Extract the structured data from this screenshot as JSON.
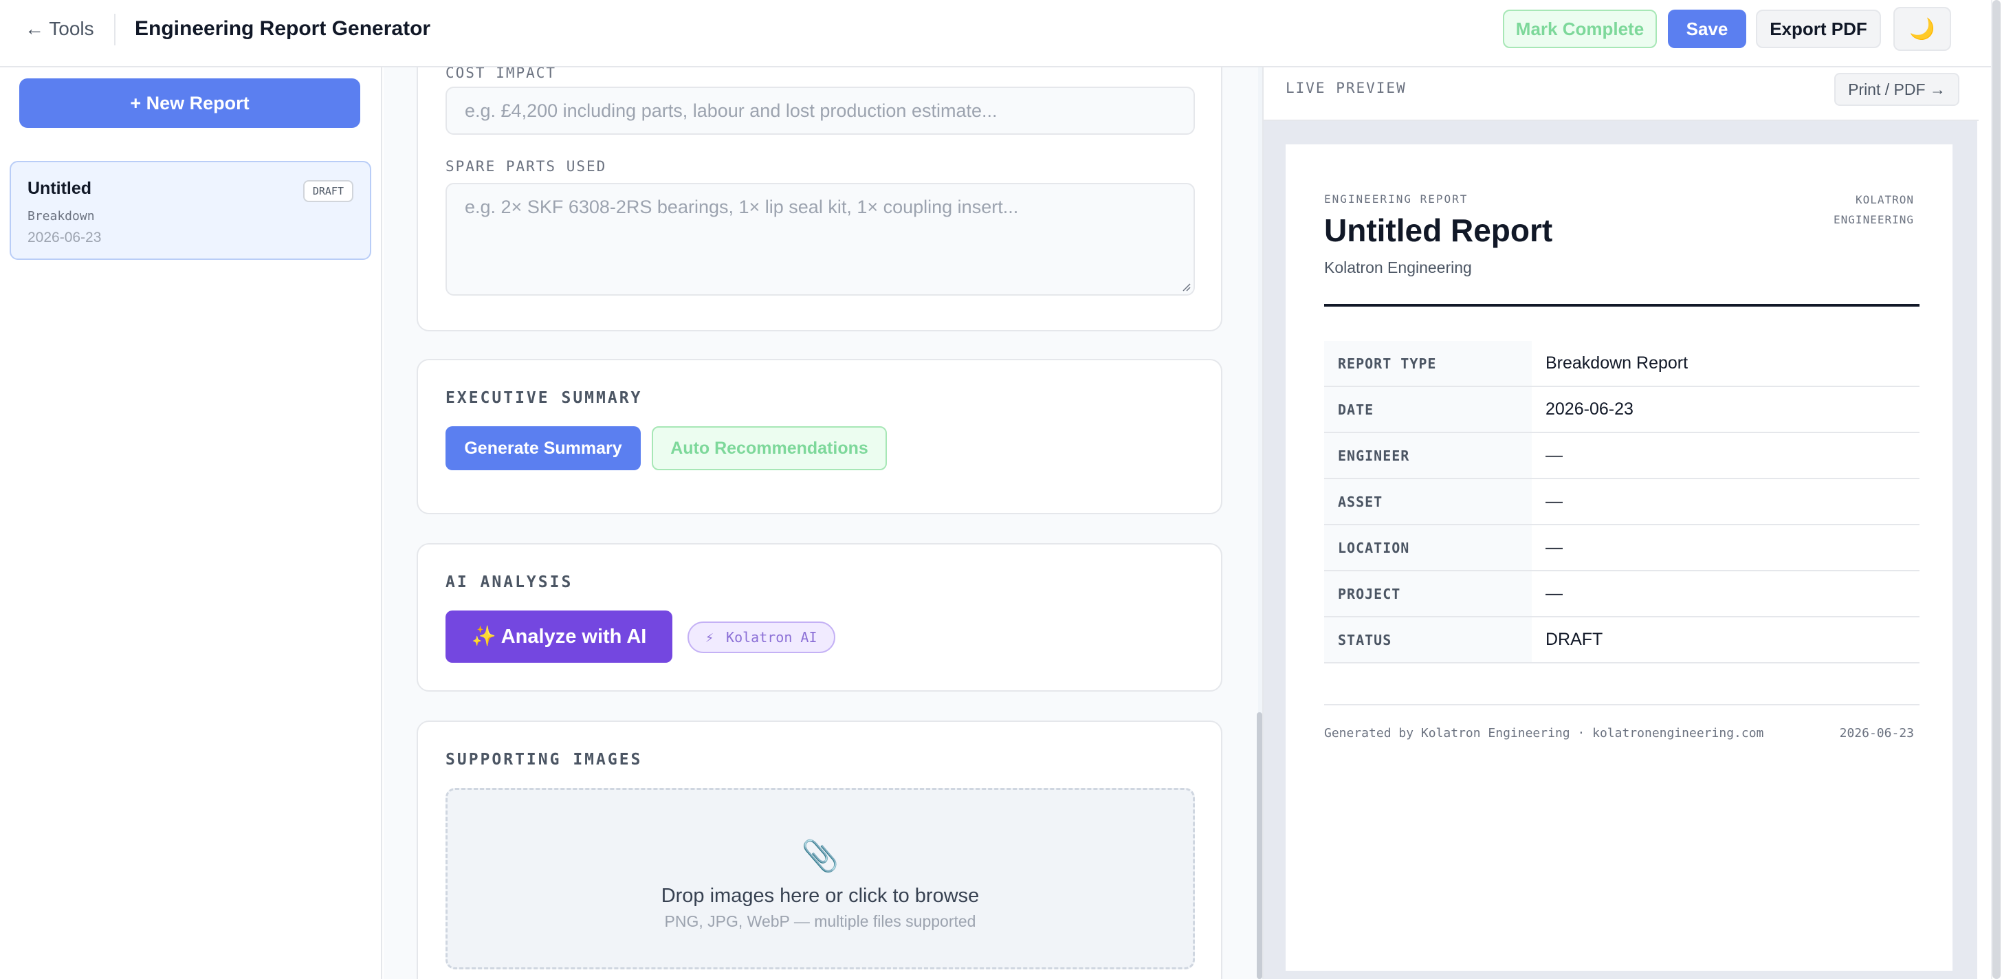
{
  "header": {
    "back_label": "← Tools",
    "title": "Engineering Report Generator",
    "mark_complete": "Mark Complete",
    "save": "Save",
    "export_pdf": "Export PDF",
    "theme_icon": "moon-icon",
    "theme_glyph": "🌙"
  },
  "sidebar": {
    "new_report": "+ New Report",
    "reports": [
      {
        "title": "Untitled",
        "badge": "DRAFT",
        "type": "Breakdown",
        "date": "2026-06-23"
      }
    ]
  },
  "form": {
    "cost_impact": {
      "label": "COST IMPACT",
      "placeholder": "e.g. £4,200 including parts, labour and lost production estimate..."
    },
    "spare_parts": {
      "label": "SPARE PARTS USED",
      "placeholder": "e.g. 2× SKF 6308-2RS bearings, 1× lip seal kit, 1× coupling insert..."
    },
    "executive_summary": {
      "title": "EXECUTIVE SUMMARY",
      "generate": "Generate Summary",
      "auto": "Auto Recommendations"
    },
    "ai_analysis": {
      "title": "AI ANALYSIS",
      "analyze": "✨ Analyze with AI",
      "badge_icon": "⚡",
      "badge": "Kolatron AI"
    },
    "supporting_images": {
      "title": "SUPPORTING IMAGES",
      "icon": "📎",
      "drop": "Drop images here or click to browse",
      "hint": "PNG, JPG, WebP — multiple files supported"
    }
  },
  "preview": {
    "label": "LIVE PREVIEW",
    "print": "Print / PDF →",
    "doc": {
      "kicker": "ENGINEERING REPORT",
      "brand_line1": "KOLATRON",
      "brand_line2": "ENGINEERING",
      "title": "Untitled Report",
      "subtitle": "Kolatron Engineering",
      "meta": [
        {
          "key": "REPORT TYPE",
          "value": "Breakdown Report"
        },
        {
          "key": "DATE",
          "value": "2026-06-23"
        },
        {
          "key": "ENGINEER",
          "value": "—"
        },
        {
          "key": "ASSET",
          "value": "—"
        },
        {
          "key": "LOCATION",
          "value": "—"
        },
        {
          "key": "PROJECT",
          "value": "—"
        },
        {
          "key": "STATUS",
          "value": "DRAFT"
        }
      ],
      "footer": "Generated by Kolatron Engineering · kolatronengineering.com",
      "footer_date": "2026-06-23"
    }
  }
}
